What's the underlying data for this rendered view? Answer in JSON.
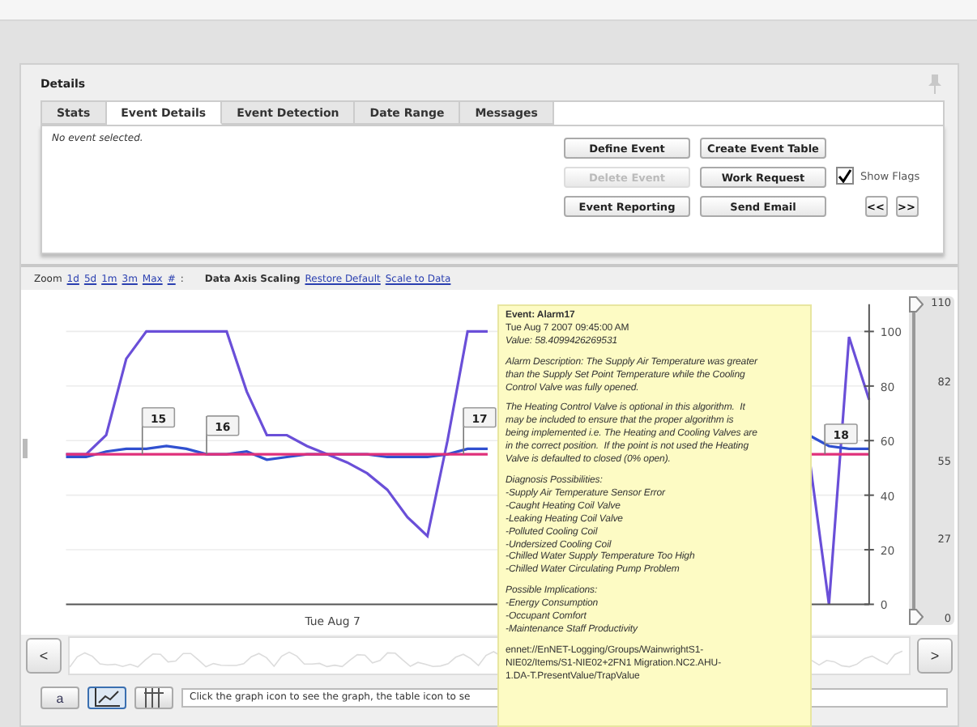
{
  "panel": {
    "title": "Details"
  },
  "tabs": [
    {
      "label": "Stats",
      "selected": false
    },
    {
      "label": "Event Details",
      "selected": true
    },
    {
      "label": "Event Detection",
      "selected": false
    },
    {
      "label": "Date Range",
      "selected": false
    },
    {
      "label": "Messages",
      "selected": false
    }
  ],
  "event_status": "No event selected.",
  "buttons": [
    {
      "label": "Define Event",
      "disabled": false
    },
    {
      "label": "Create Event Table",
      "disabled": false
    },
    {
      "label": "Delete Event",
      "disabled": true
    },
    {
      "label": "Work Request",
      "disabled": false
    },
    {
      "label": "Event Reporting",
      "disabled": false
    },
    {
      "label": "Send Email",
      "disabled": false
    }
  ],
  "show_flags": {
    "label": "Show Flags",
    "checked": true
  },
  "nav_buttons": [
    "<<",
    ">>"
  ],
  "zoom_bar": {
    "label": "Zoom",
    "links": [
      "1d",
      "5d",
      "1m",
      "3m",
      "Max",
      "#"
    ],
    "separator": ":"
  },
  "scaling": {
    "label": "Data Axis Scaling",
    "links": [
      "Restore Default",
      "Scale to Data"
    ]
  },
  "chart": {
    "axis_labels": [
      "100",
      "80",
      "60",
      "40",
      "20",
      "0"
    ],
    "flags": [
      "15",
      "16",
      "17",
      "18"
    ],
    "date_label": "Tue Aug 7"
  },
  "range_slider": {
    "labels": [
      "110",
      "82",
      "55",
      "27",
      "0"
    ],
    "handles": [
      {
        "level": 1
      },
      {
        "level": 0
      }
    ]
  },
  "navigator": {
    "prev": "<",
    "next": ">"
  },
  "toolbar": {
    "views": [
      {
        "kind": "text",
        "label": "a",
        "selected": false
      },
      {
        "kind": "graph",
        "selected": true
      },
      {
        "kind": "table",
        "selected": false
      }
    ],
    "hint": "Click the graph icon to see the graph, the table icon to se"
  },
  "tooltip": {
    "title": "Event: Alarm17",
    "time": "Tue Aug 7 2007 09:45:00 AM",
    "value": "Value: 58.4099426269531",
    "description": [
      "Alarm Description: The Supply Air Temperature was greater",
      "than the Supply Set Point Temperature while the Cooling",
      "Control Valve was fully opened."
    ],
    "note": [
      "The Heating Control Valve is optional in this algorithm.  It",
      "may be included to ensure that the proper algorithm is",
      "being implemented i.e. The Heating and Cooling Valves are",
      "in the correct position.  If the point is not used the Heating",
      "Valve is defaulted to closed (0% open)."
    ],
    "diagnosis": [
      "Diagnosis Possibilities:",
      "-Supply Air Temperature Sensor Error",
      "-Caught Heating Coil Valve",
      "-Leaking Heating Coil Valve",
      "-Polluted Cooling Coil",
      "-Undersized Cooling Coil",
      "-Chilled Water Supply Temperature Too High",
      "-Chilled Water Circulating Pump Problem"
    ],
    "implications": [
      "Possible Implications:",
      "-Energy Consumption",
      "-Occupant Comfort",
      "-Maintenance Staff Productivity"
    ],
    "point_path": [
      "ennet://EnNET-Logging/Groups/WainwrightS1-",
      "NIE02/Items/S1-NIE02+2FN1 Migration.NC2.AHU-",
      "1.DA-T.PresentValue/TrapValue"
    ]
  }
}
